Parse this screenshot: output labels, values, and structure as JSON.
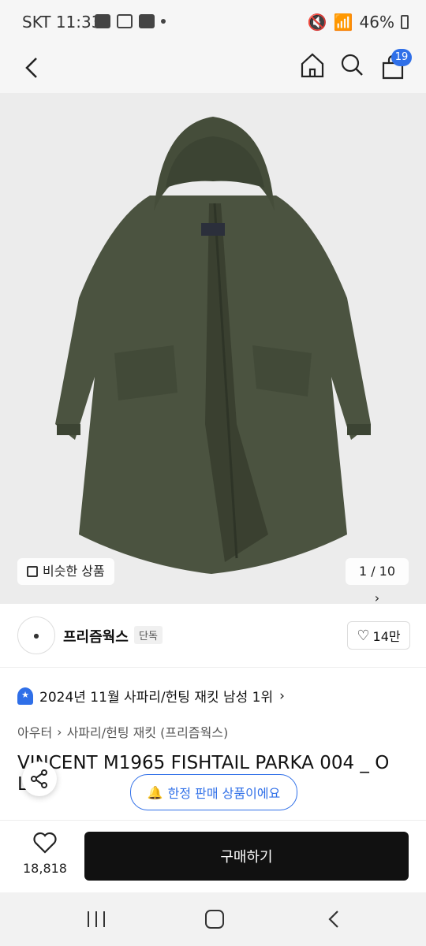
{
  "status_bar": {
    "time": "SKT 11:33",
    "left_icons": [
      "bird-icon",
      "fit-icon",
      "lf-icon",
      "dot-icon"
    ],
    "battery": "46%"
  },
  "nav": {
    "cart_count": "19"
  },
  "hero": {
    "similar_label": "비슷한 상품",
    "pager": "1 / 10"
  },
  "shop": {
    "name": "프리즘웍스",
    "exclusive": "단독",
    "likes": "14만"
  },
  "rank_text": "2024년 11월 사파리/헌팅 재킷 남성 1위",
  "breadcrumb": {
    "level1": "아우터",
    "level2": "사파리/헌팅 재킷 (프리즘웍스)"
  },
  "product": {
    "title_line1": "VINCENT M1965 FISHTAIL PARKA 004 _ O",
    "title_line2": "L..."
  },
  "limited_label": "한정 판매 상품이에요",
  "bottom": {
    "wish_count": "18,818",
    "buy_label": "구매하기"
  },
  "colors": {
    "accent": "#2f6fe8",
    "jacket": "#4b5340"
  }
}
